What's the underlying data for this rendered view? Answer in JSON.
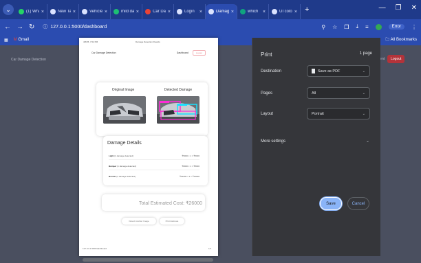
{
  "browser": {
    "tabs": [
      {
        "title": "(1) Wha",
        "favicon_color": "#25d366"
      },
      {
        "title": "New Ta",
        "favicon_color": "#dbe3ff"
      },
      {
        "title": "Vehicle",
        "favicon_color": "#dbe3ff"
      },
      {
        "title": "mild da",
        "favicon_color": "#1dbf73"
      },
      {
        "title": "Car Da",
        "favicon_color": "#ea4335"
      },
      {
        "title": "Login",
        "favicon_color": "#dbe3ff"
      },
      {
        "title": "Damag",
        "favicon_color": "#dbe3ff"
      },
      {
        "title": "which",
        "favicon_color": "#10a37f"
      },
      {
        "title": "UI colo",
        "favicon_color": "#dbe3ff"
      }
    ],
    "address": "127.0.0.1:5000/dashboard",
    "error_pill": "Error",
    "bookmarks": {
      "gmail": "Gmail",
      "all": "All Bookmarks"
    }
  },
  "app_bg": {
    "brand": "Car Damage Detection",
    "tab_label": "ment",
    "logout": "Logout"
  },
  "preview": {
    "meta_left": "4/5/25, 7:02 PM",
    "meta_center": "Damage Detection Results",
    "nav_brand": "Car Damage Detection",
    "nav_dashboard": "Dashboard",
    "nav_logout": "Logout",
    "original_label": "Original Image",
    "detected_label": "Detected Damage",
    "details_title": "Damage Details",
    "details": [
      {
        "part": "Light",
        "note": "(1 damage detected)",
        "amount": "₹5000 × 1 = ₹5000"
      },
      {
        "part": "Bumper",
        "note": "(1 damage detected)",
        "amount": "₹8000 × 1 = ₹8000"
      },
      {
        "part": "Bonnet",
        "note": "(1 damage detected)",
        "amount": "₹13000 × 1 = ₹13000"
      }
    ],
    "total": "Total Estimated Cost: ₹26000",
    "btn_detect": "Detect Another Image",
    "btn_print": "Print Estimate",
    "footer_left": "127.0.0.1:5000/dashboard",
    "footer_right": "1/1"
  },
  "print_panel": {
    "title": "Print",
    "pages_count": "1 page",
    "destination_label": "Destination",
    "destination_value": "Save as PDF",
    "pages_label": "Pages",
    "pages_value": "All",
    "layout_label": "Layout",
    "layout_value": "Portrait",
    "more_settings": "More settings",
    "save": "Save",
    "cancel": "Cancel"
  },
  "colors": {
    "accent": "#8ab4f8",
    "panel_bg": "#35363a",
    "chrome": "#2b4cb0",
    "logout": "#b3333a"
  }
}
